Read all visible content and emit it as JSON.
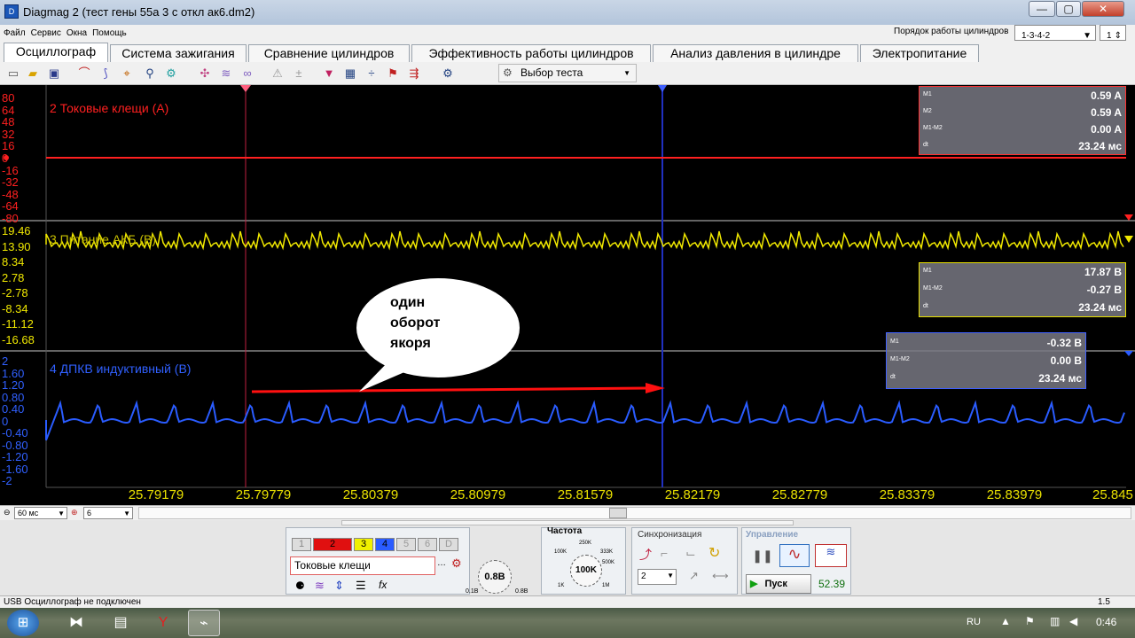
{
  "window": {
    "title": "Diagmag 2 (тест гены 55а 3 с откл ак6.dm2)",
    "minimize": "—",
    "maximize": "▢",
    "close": "✕"
  },
  "menu": {
    "items": [
      "Файл",
      "Сервис",
      "Окна",
      "Помощь"
    ],
    "order_label": "Порядок работы цилиндров",
    "order_value": "1-3-4-2",
    "cyl_value": "1"
  },
  "tabs": [
    "Осциллограф",
    "Система зажигания",
    "Сравнение цилиндров",
    "Эффективность работы цилиндров",
    "Анализ давления в цилиндре",
    "Электропитание"
  ],
  "toolbar": {
    "test_select": "Выбор теста"
  },
  "channels": {
    "ch2": {
      "label": "2 Токовые клещи (А)",
      "ticks": [
        "80",
        "64",
        "48",
        "32",
        "16",
        "0",
        "-16",
        "-32",
        "-48",
        "-64",
        "-80"
      ],
      "color": "#ff2020",
      "meas": [
        {
          "k": "M1",
          "v": "0.59 A"
        },
        {
          "k": "M2",
          "v": "0.59 A"
        },
        {
          "k": "M1-M2",
          "v": "0.00 A"
        },
        {
          "k": "dt",
          "v": "23.24 мс"
        }
      ]
    },
    "ch3": {
      "label": "3 Питание АКБ (В)",
      "ticks": [
        "19.46",
        "13.90",
        "8.34",
        "2.78",
        "-2.78",
        "-8.34",
        "-11.12",
        "-16.68"
      ],
      "color": "#f0e800",
      "meas": [
        {
          "k": "M1",
          "v": "17.87 В"
        },
        {
          "k": "M1-M2",
          "v": "-0.27 В"
        },
        {
          "k": "dt",
          "v": "23.24 мс"
        }
      ]
    },
    "ch4": {
      "label": "4 ДПКВ индуктивный (В)",
      "ticks": [
        "2",
        "1.60",
        "1.20",
        "0.80",
        "0.40",
        "0",
        "-0.40",
        "-0.80",
        "-1.20",
        "-1.60",
        "-2"
      ],
      "color": "#3060ff",
      "meas": [
        {
          "k": "M1",
          "v": "-0.32 В"
        },
        {
          "k": "M1-M2",
          "v": "0.00 В"
        },
        {
          "k": "dt",
          "v": "23.24 мс"
        }
      ]
    }
  },
  "annotation": {
    "text": "один\nоборот\nякоря"
  },
  "xaxis": [
    "25.79179",
    "25.79779",
    "25.80379",
    "25.80979",
    "25.81579",
    "25.82179",
    "25.82779",
    "25.83379",
    "25.83979",
    "25.845"
  ],
  "timebase": {
    "value": "60 мс",
    "count": "6"
  },
  "panel": {
    "channels": [
      "1",
      "2",
      "3",
      "4",
      "5",
      "6",
      "D"
    ],
    "input_name": "Токовые клещи",
    "knob": {
      "value": "0.8В",
      "min": "0.1В",
      "max": "0.8В"
    },
    "freq": {
      "title": "Частота",
      "center": "100K",
      "labels": [
        "250K",
        "100K",
        "333K",
        "500K",
        "1K",
        "1M"
      ]
    },
    "sync": {
      "title": "Синхронизация",
      "channel": "2"
    },
    "control": {
      "title": "Управление",
      "start": "Пуск",
      "value": "52.39"
    }
  },
  "status": {
    "text": "USB Осциллограф не подключен",
    "right": "1.5"
  },
  "taskbar": {
    "lang": "RU",
    "time": "0:46"
  }
}
